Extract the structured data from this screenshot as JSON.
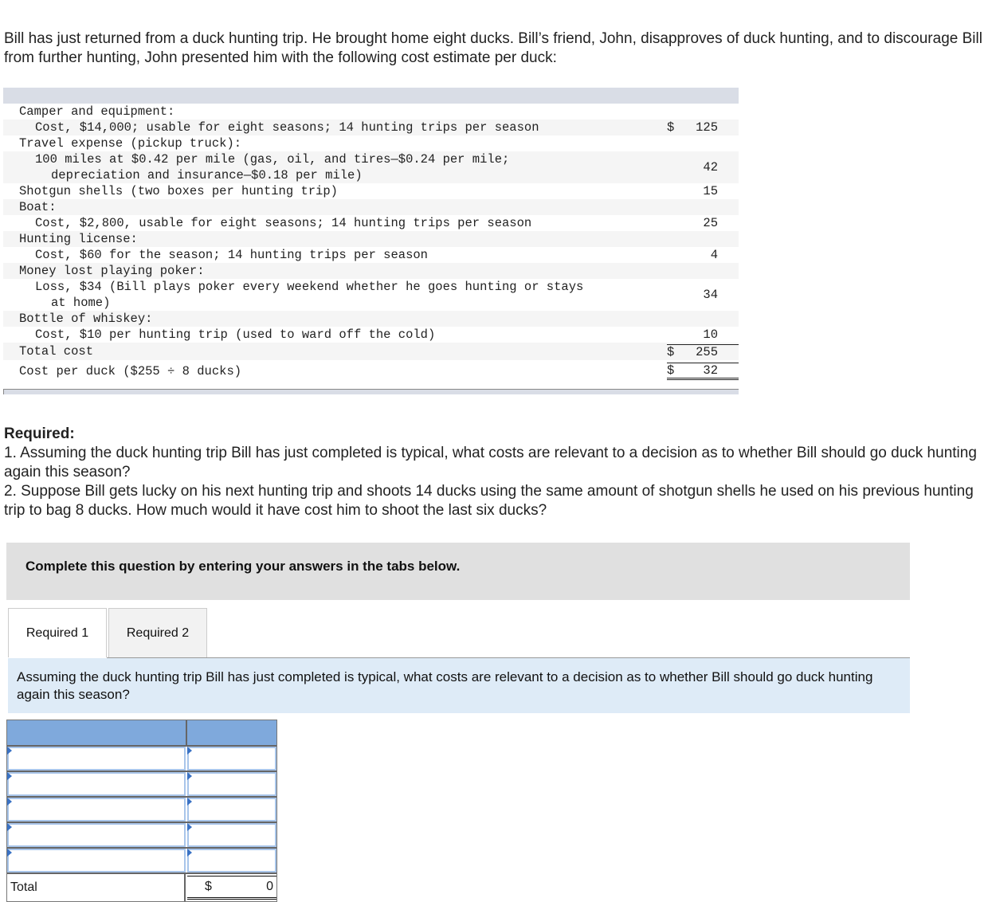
{
  "intro": "Bill has just returned from a duck hunting trip. He brought home eight ducks. Bill’s friend, John, disapproves of duck hunting, and to discourage Bill from further hunting, John presented him with the following cost estimate per duck:",
  "estimate": {
    "rows": [
      {
        "label": "Camper and equipment:",
        "indent": 0,
        "dollar": "",
        "amount": ""
      },
      {
        "label": "Cost, $14,000; usable for eight seasons; 14 hunting trips per season",
        "indent": 1,
        "dollar": "$",
        "amount": "125"
      },
      {
        "label": "Travel expense (pickup truck):",
        "indent": 0,
        "dollar": "",
        "amount": ""
      },
      {
        "label": "100 miles at $0.42 per mile (gas, oil, and tires—$0.24 per mile;",
        "label_cont": "depreciation and insurance—$0.18 per mile)",
        "indent": 1,
        "dollar": "",
        "amount": "42"
      },
      {
        "label": "Shotgun shells (two boxes per hunting trip)",
        "indent": 0,
        "dollar": "",
        "amount": "15"
      },
      {
        "label": "Boat:",
        "indent": 0,
        "dollar": "",
        "amount": ""
      },
      {
        "label": "Cost, $2,800, usable for eight seasons; 14 hunting trips per season",
        "indent": 1,
        "dollar": "",
        "amount": "25"
      },
      {
        "label": "Hunting license:",
        "indent": 0,
        "dollar": "",
        "amount": ""
      },
      {
        "label": "Cost, $60 for the season; 14 hunting trips per season",
        "indent": 1,
        "dollar": "",
        "amount": "4"
      },
      {
        "label": "Money lost playing poker:",
        "indent": 0,
        "dollar": "",
        "amount": ""
      },
      {
        "label": "Loss, $34 (Bill plays poker every weekend whether he goes hunting or stays",
        "label_cont": "at home)",
        "indent": 1,
        "dollar": "",
        "amount": "34"
      },
      {
        "label": "Bottle of whiskey:",
        "indent": 0,
        "dollar": "",
        "amount": ""
      },
      {
        "label": "Cost, $10 per hunting trip (used to ward off the cold)",
        "indent": 1,
        "dollar": "",
        "amount": "10"
      }
    ],
    "total": {
      "label": "Total cost",
      "dollar": "$",
      "amount": "255"
    },
    "per_duck": {
      "label": "Cost per duck ($255 ÷ 8 ducks)",
      "dollar": "$",
      "amount": "32"
    }
  },
  "required": {
    "heading": "Required:",
    "items": [
      "1.  Assuming the duck hunting trip Bill has just completed is typical, what costs are relevant to a decision as to whether Bill should go duck hunting again this season?",
      "2. Suppose Bill gets lucky on his next hunting trip and shoots 14 ducks using the same amount of shotgun shells he used on his previous hunting trip to bag 8 ducks. How much would it have cost him to shoot the last six ducks?"
    ]
  },
  "banner": "Complete this question by entering your answers in the tabs below.",
  "tabs": [
    {
      "label": "Required 1",
      "active": true
    },
    {
      "label": "Required 2",
      "active": false
    }
  ],
  "question": "Assuming the duck hunting trip Bill has just completed is typical, what costs are relevant to a decision as to whether Bill should go duck hunting again this season?",
  "answer_table": {
    "rows": [
      {
        "item": "",
        "amount": ""
      },
      {
        "item": "",
        "amount": ""
      },
      {
        "item": "",
        "amount": ""
      },
      {
        "item": "",
        "amount": ""
      },
      {
        "item": "",
        "amount": ""
      }
    ],
    "total_label": "Total",
    "total_dollar": "$",
    "total_value": "0"
  }
}
